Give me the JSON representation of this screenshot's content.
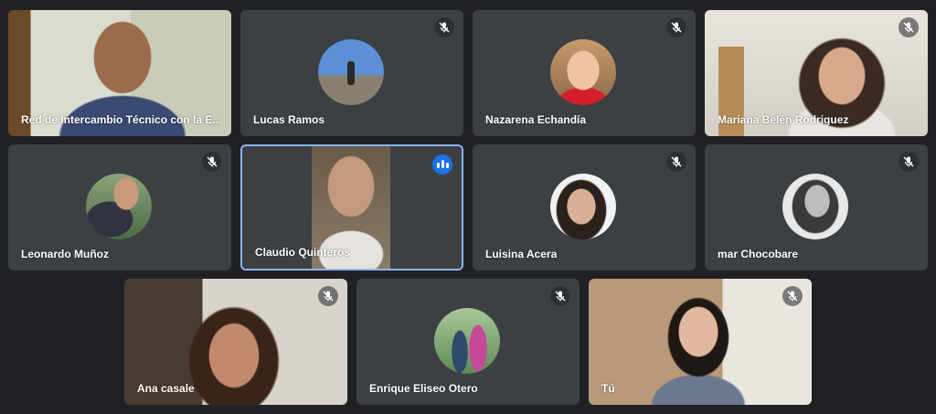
{
  "participants": [
    {
      "name": "Red de Intercambio Técnico con la E..."
    },
    {
      "name": "Lucas Ramos"
    },
    {
      "name": "Nazarena Echandía"
    },
    {
      "name": "Mariana Belén Rodriguez"
    },
    {
      "name": "Leonardo Muñoz"
    },
    {
      "name": "Claudio Quinteros"
    },
    {
      "name": "Luisina Acera"
    },
    {
      "name": "mar Chocobare"
    },
    {
      "name": "Ana casale"
    },
    {
      "name": "Enrique Eliseo Otero"
    },
    {
      "name": "Tú"
    }
  ],
  "icons": {
    "muted": "mic-off-icon",
    "speaking": "speaking-indicator-icon"
  },
  "colors": {
    "background": "#202124",
    "tile": "#3c4043",
    "active_border": "#8ab4f8",
    "speaking": "#1a73e8"
  }
}
